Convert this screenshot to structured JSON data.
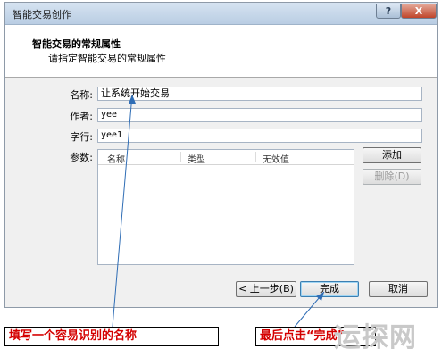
{
  "window": {
    "title": "智能交易创作",
    "help_label": "?",
    "close_label": "X"
  },
  "header": {
    "title": "智能交易的常规属性",
    "subtitle": "请指定智能交易的常规属性"
  },
  "form": {
    "name_label": "名称:",
    "name_value": "让系统开始交易",
    "author_label": "作者:",
    "author_value": "yee",
    "link_label": "字行:",
    "link_value": "yee1",
    "params_label": "参数:"
  },
  "params_table": {
    "columns": [
      "名称",
      "类型",
      "无效值"
    ],
    "rows": []
  },
  "buttons": {
    "add": "添加",
    "delete": "删除(D)",
    "back": "< 上一步(B)",
    "finish": "完成",
    "cancel": "取消"
  },
  "annotations": {
    "left_caption": "填写一个容易识别的名称",
    "right_caption": "最后点击“完成”",
    "text_color": "#d40000",
    "arrow_color": "#2f6db5"
  },
  "watermark": "运探网"
}
